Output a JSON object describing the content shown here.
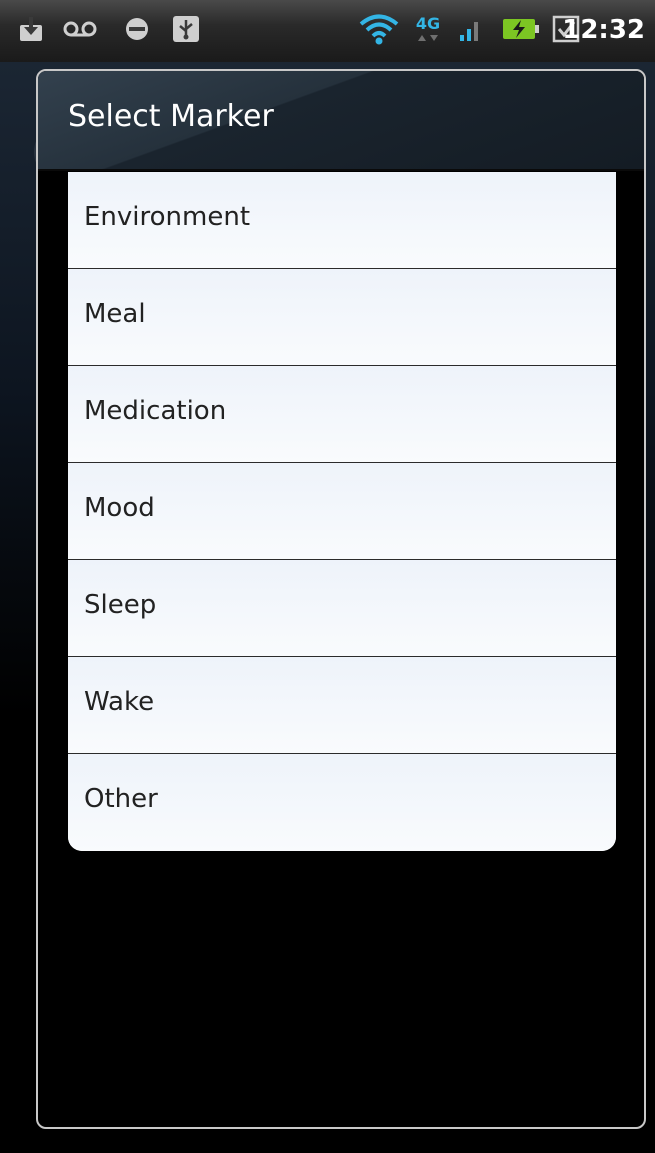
{
  "status_bar": {
    "time": "12:32",
    "network_label": "4G",
    "icons": [
      "download-icon",
      "voicemail-icon",
      "sync-icon",
      "usb-icon",
      "wifi-icon",
      "4g-lte-icon",
      "signal-icon",
      "battery-charging-icon",
      "checkbox-icon"
    ]
  },
  "dialog": {
    "title": "Select Marker",
    "items": [
      {
        "label": "Environment"
      },
      {
        "label": "Meal"
      },
      {
        "label": "Medication"
      },
      {
        "label": "Mood"
      },
      {
        "label": "Sleep"
      },
      {
        "label": "Wake"
      },
      {
        "label": "Other"
      }
    ]
  },
  "colors": {
    "status_bar_bg": "#2a2a2a",
    "dialog_header_bg": "#25313c",
    "list_item_bg": "#eef3fa",
    "wifi_accent": "#33b5e5",
    "signal_accent": "#33b5e5",
    "battery_accent": "#7cc623"
  }
}
